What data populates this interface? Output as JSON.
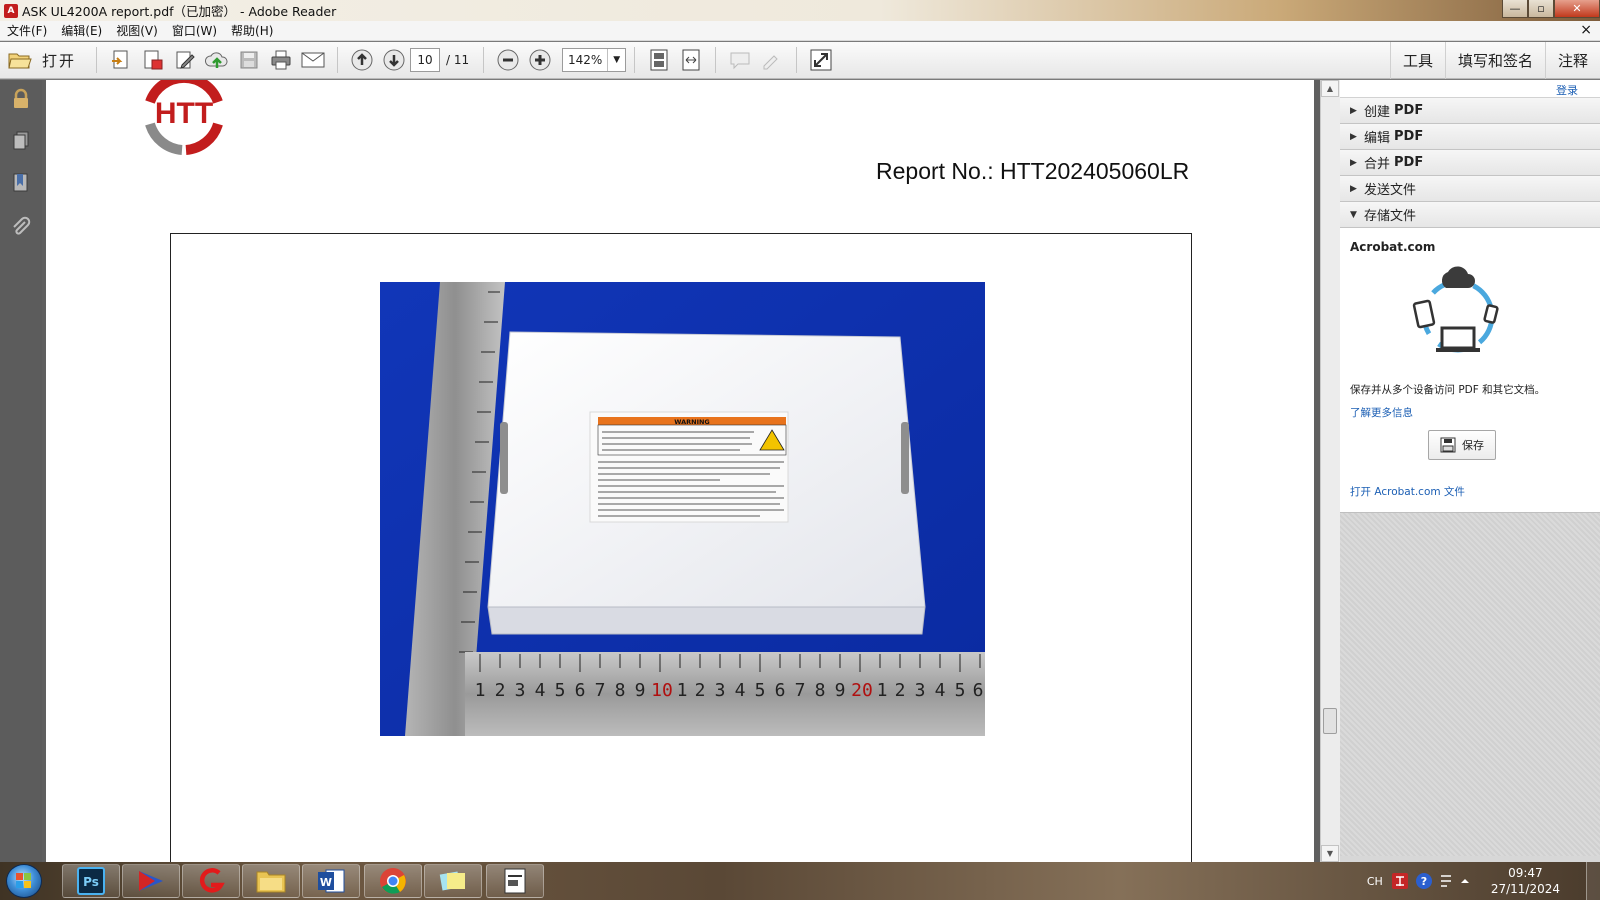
{
  "window": {
    "title": "ASK UL4200A report.pdf（已加密） - Adobe Reader",
    "min": "—",
    "max": "▫",
    "close": "✕"
  },
  "menu": [
    "文件(F)",
    "编辑(E)",
    "视图(V)",
    "窗口(W)",
    "帮助(H)"
  ],
  "menu_close": "×",
  "toolbar": {
    "open_label": "打开",
    "page_current": "10",
    "page_total": "/ 11",
    "zoom": "142%",
    "tabs": [
      "工具",
      "填写和签名",
      "注释"
    ]
  },
  "document": {
    "logo_text": "HTT",
    "report_no": "Report No.: HTT202405060LR",
    "label_header": "WARNING",
    "ruler_marks": [
      "1",
      "2",
      "3",
      "4",
      "5",
      "6",
      "7",
      "8",
      "9",
      "10",
      "1",
      "2",
      "3",
      "4",
      "5",
      "6",
      "7",
      "8",
      "9",
      "20",
      "1",
      "2",
      "3",
      "4",
      "5",
      "6"
    ]
  },
  "right_panel": {
    "login": "登录",
    "sections": [
      {
        "label": "创建",
        "bold": "PDF",
        "expanded": false
      },
      {
        "label": "编辑",
        "bold": "PDF",
        "expanded": false
      },
      {
        "label": "合并",
        "bold": "PDF",
        "expanded": false
      },
      {
        "label": "发送文件",
        "bold": "",
        "expanded": false
      },
      {
        "label": "存储文件",
        "bold": "",
        "expanded": true
      }
    ],
    "acrobat_title": "Acrobat.com",
    "description": "保存并从多个设备访问 PDF 和其它文档。",
    "learn_more": "了解更多信息",
    "save_button": "保存",
    "open_link": "打开 Acrobat.com 文件"
  },
  "taskbar": {
    "apps": [
      "photoshop",
      "app-2",
      "app-3",
      "file-explorer",
      "word",
      "chrome",
      "app-7",
      "app-8"
    ],
    "tray_lang": "CH",
    "time": "09:47",
    "date": "27/11/2024"
  }
}
